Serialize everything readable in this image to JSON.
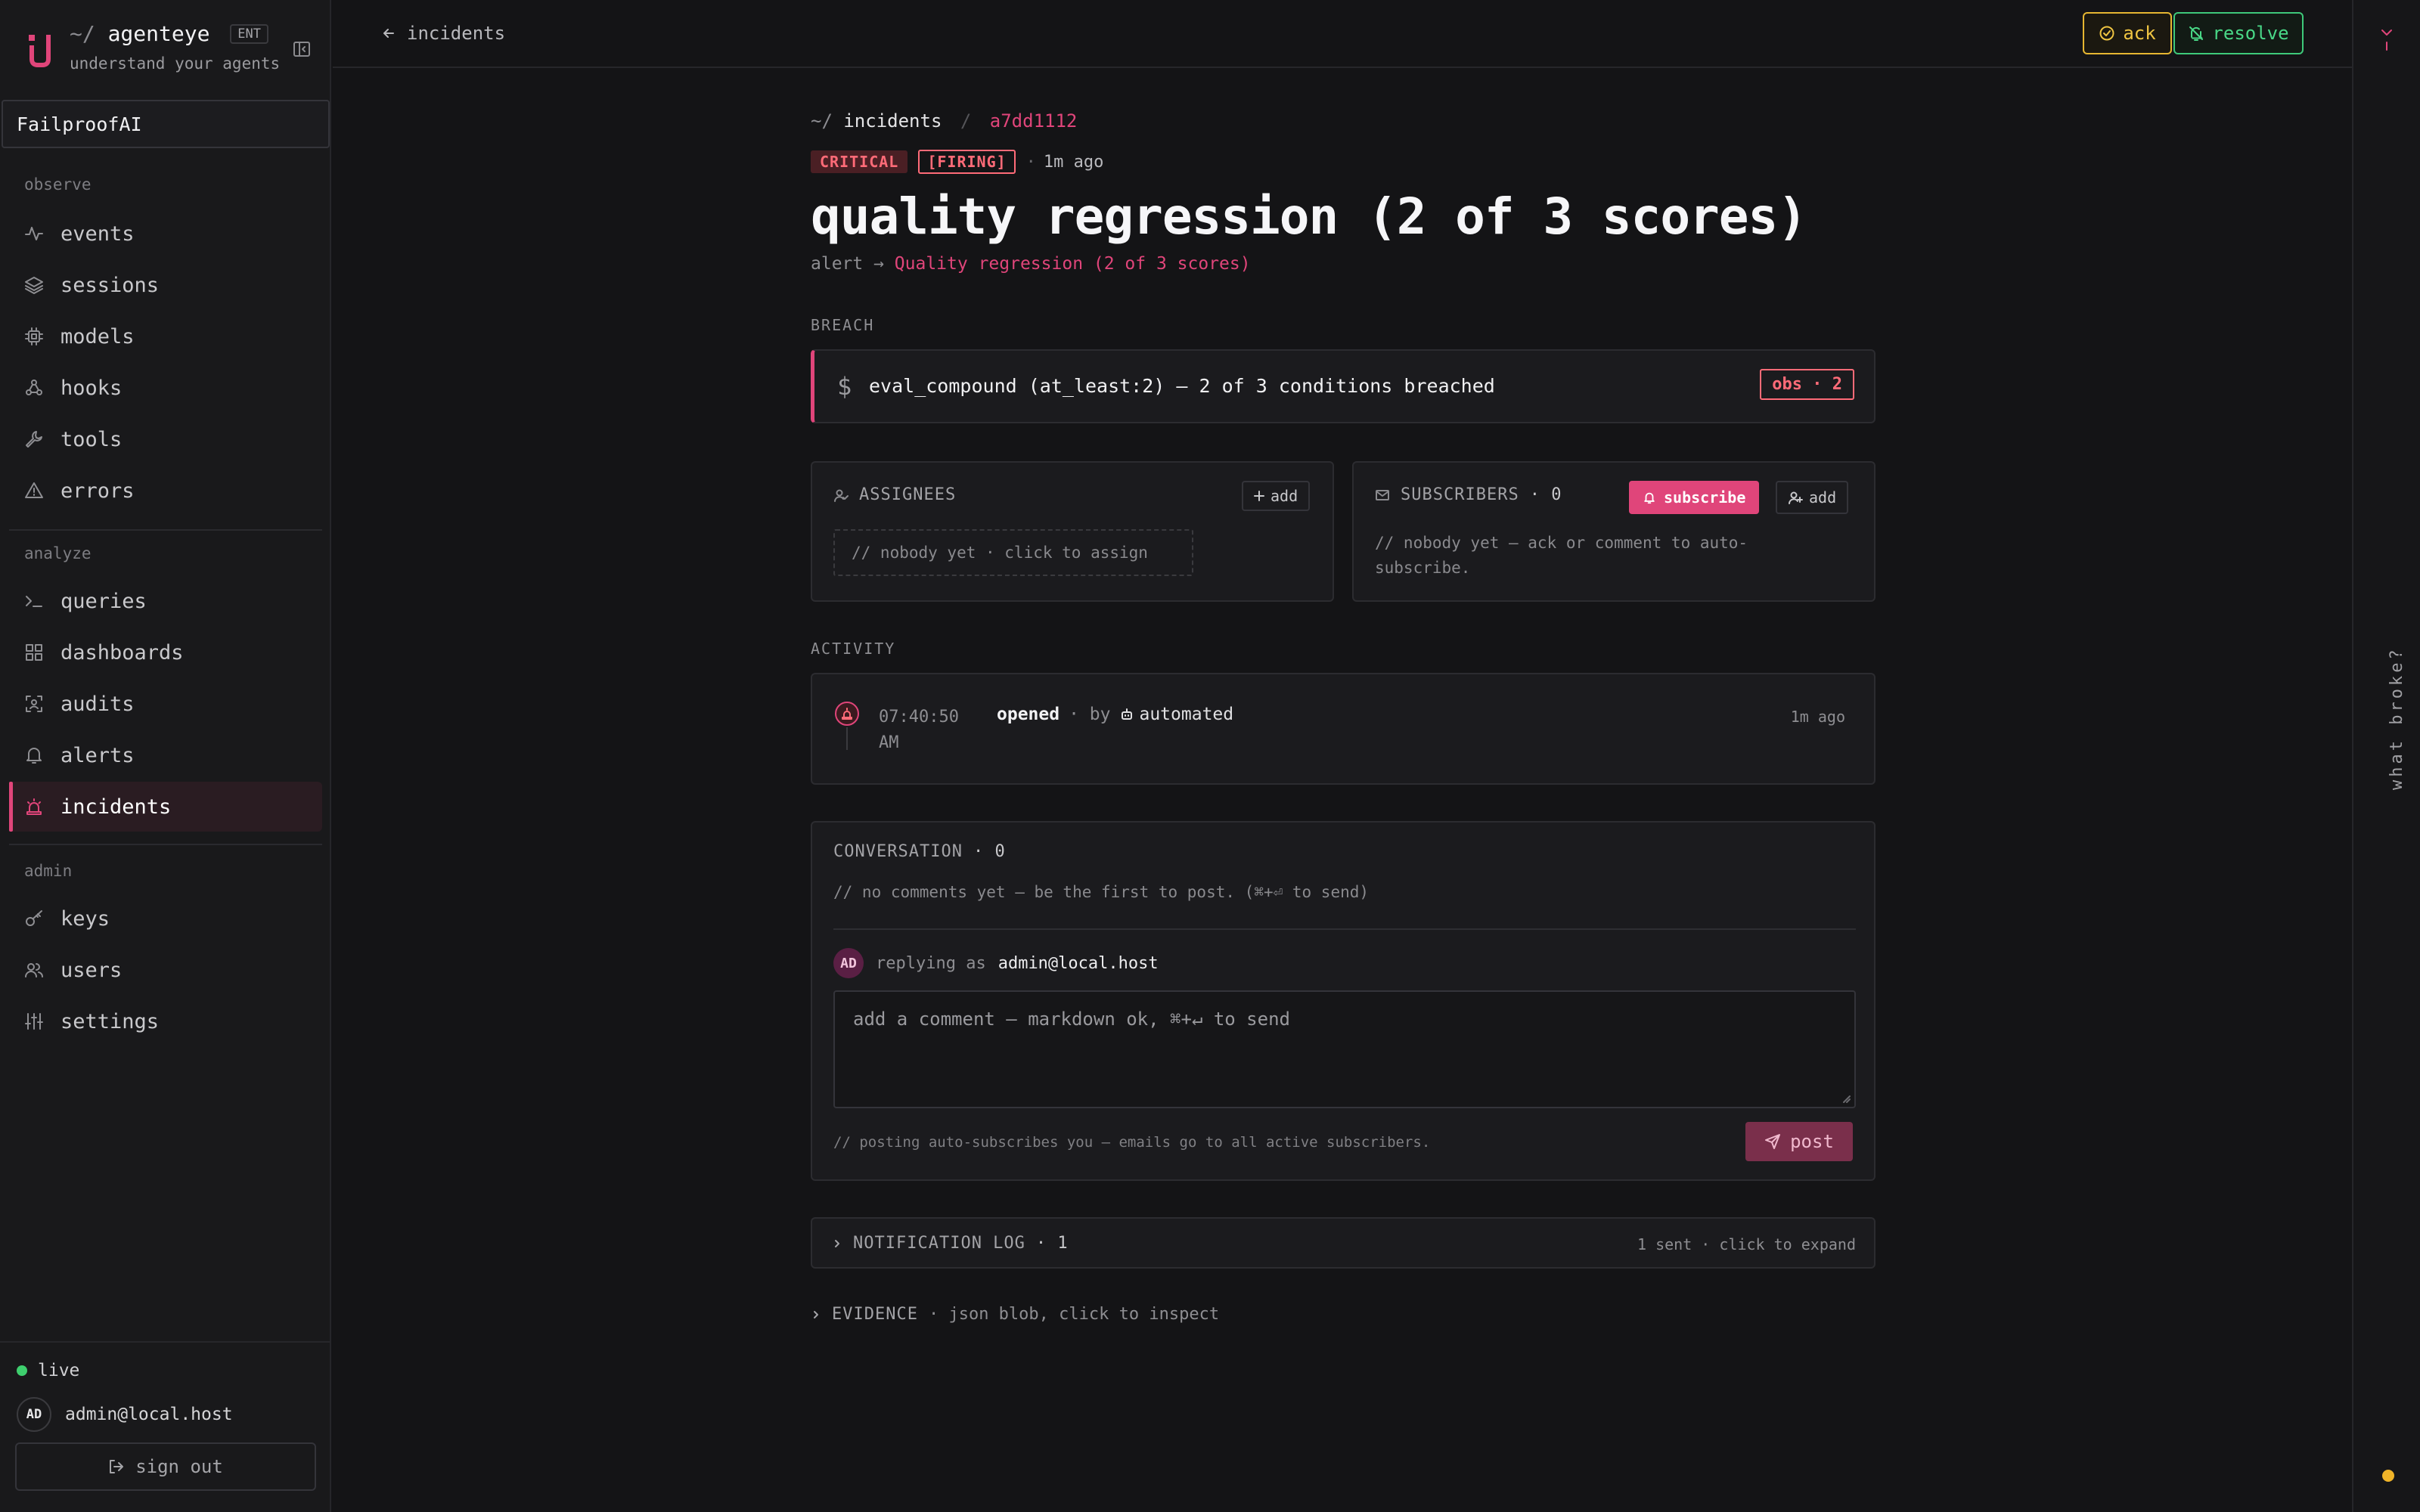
{
  "brand": {
    "prefix": "~/",
    "name": "agenteye",
    "badge": "ENT",
    "tagline": "understand your agents"
  },
  "org": "FailproofAI",
  "nav": {
    "sections": {
      "observe": "observe",
      "analyze": "analyze",
      "admin": "admin"
    },
    "items": [
      {
        "label": "events",
        "icon": "activity-icon"
      },
      {
        "label": "sessions",
        "icon": "layers-icon"
      },
      {
        "label": "models",
        "icon": "cpu-icon"
      },
      {
        "label": "hooks",
        "icon": "webhook-icon"
      },
      {
        "label": "tools",
        "icon": "wrench-icon"
      },
      {
        "label": "errors",
        "icon": "warning-icon"
      },
      {
        "label": "queries",
        "icon": "terminal-icon"
      },
      {
        "label": "dashboards",
        "icon": "grid-icon"
      },
      {
        "label": "audits",
        "icon": "scan-icon"
      },
      {
        "label": "alerts",
        "icon": "bell-icon"
      },
      {
        "label": "incidents",
        "icon": "siren-icon",
        "active": true
      },
      {
        "label": "keys",
        "icon": "key-icon"
      },
      {
        "label": "users",
        "icon": "users-icon"
      },
      {
        "label": "settings",
        "icon": "sliders-icon"
      }
    ]
  },
  "footer": {
    "status": "live",
    "avatar_initials": "AD",
    "user_email": "admin@local.host",
    "sign_out": "sign out"
  },
  "topbar": {
    "back_label": "incidents",
    "ack_label": "ack",
    "resolve_label": "resolve"
  },
  "rail": {
    "label": "what broke?"
  },
  "incident": {
    "breadcrumb_prefix": "~/",
    "breadcrumb_parent": "incidents",
    "breadcrumb_sep": "/",
    "id": "a7dd1112",
    "severity": "CRITICAL",
    "state": "[FIRING]",
    "age": "1m ago",
    "title": "quality regression (2 of 3 scores)",
    "alert_prefix": "alert →",
    "alert_name": "Quality regression (2 of 3 scores)"
  },
  "breach": {
    "section_label": "BREACH",
    "symbol": "$",
    "message": "eval_compound (at_least:2) — 2 of 3 conditions breached",
    "badge": "obs · 2"
  },
  "assignees": {
    "label": "ASSIGNEES",
    "add_label": "add",
    "empty": "// nobody yet · click to assign"
  },
  "subscribers": {
    "label": "SUBSCRIBERS",
    "count": "· 0",
    "subscribe_label": "subscribe",
    "add_label": "add",
    "empty": "// nobody yet — ack or comment to auto-subscribe."
  },
  "activity": {
    "section_label": "ACTIVITY",
    "time": "07:40:50 AM",
    "event": "opened",
    "by": "· by",
    "actor": "automated",
    "ago": "1m ago"
  },
  "conversation": {
    "label": "CONVERSATION",
    "count": "· 0",
    "empty": "// no comments yet — be the first to post. (⌘+⏎ to send)",
    "replying_as": "replying as",
    "reply_initials": "AD",
    "reply_email": "admin@local.host",
    "placeholder": "add a comment — markdown ok, ⌘+↵ to send",
    "hint": "// posting auto-subscribes you — emails go to all active subscribers.",
    "post_label": "post"
  },
  "notification_log": {
    "label": "NOTIFICATION LOG",
    "count": "· 1",
    "summary": "1 sent · click to expand"
  },
  "evidence": {
    "label": "EVIDENCE",
    "meta": "· json blob, click to inspect"
  },
  "colors": {
    "accent": "#e0457a",
    "critical": "#ff6b78",
    "ack": "#f0c542",
    "resolve": "#49d887",
    "live": "#3ecf6e"
  }
}
